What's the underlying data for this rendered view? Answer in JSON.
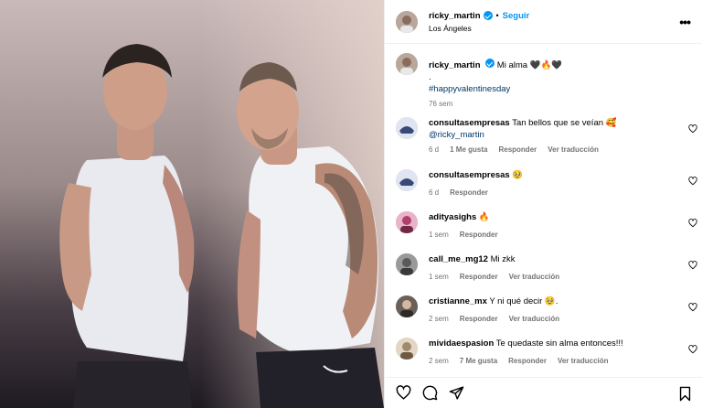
{
  "post": {
    "username": "ricky_martin",
    "follow_label": "Seguir",
    "separator": "•",
    "location": "Los Ángeles",
    "more_label": "•••"
  },
  "caption": {
    "username": "ricky_martin",
    "text": "Mi alma 🖤🔥🖤",
    "dot": ".",
    "hashtag": "#happyvalentinesday",
    "time": "76 sem"
  },
  "comments": [
    {
      "username": "consultasempresas",
      "text": "Tan bellos que se veían 🥰",
      "mention": "@ricky_martin",
      "time": "6 d",
      "likes": "1 Me gusta",
      "reply": "Responder",
      "translate": "Ver traducción",
      "avatar_color": "#3a4a78"
    },
    {
      "username": "consultasempresas",
      "text": "🥹",
      "mention": "",
      "time": "6 d",
      "likes": "",
      "reply": "Responder",
      "translate": "",
      "avatar_color": "#3a4a78"
    },
    {
      "username": "adityasighs",
      "text": "🔥",
      "mention": "",
      "time": "1 sem",
      "likes": "",
      "reply": "Responder",
      "translate": "",
      "avatar_color": "#b0406e"
    },
    {
      "username": "call_me_mg12",
      "text": "Mi zkk",
      "mention": "",
      "time": "1 sem",
      "likes": "",
      "reply": "Responder",
      "translate": "Ver traducción",
      "avatar_color": "#5a5a5a"
    },
    {
      "username": "cristianne_mx",
      "text": "Y ni qué decir 🥹.",
      "mention": "",
      "time": "2 sem",
      "likes": "",
      "reply": "Responder",
      "translate": "Ver traducción",
      "avatar_color": "#2e2a28"
    },
    {
      "username": "mividaespasion",
      "text": "Te quedaste sin alma entonces!!!",
      "mention": "",
      "time": "2 sem",
      "likes": "7 Me gusta",
      "reply": "Responder",
      "translate": "Ver traducción",
      "avatar_color": "#a08a6e"
    }
  ],
  "colors": {
    "verified": "#0095f6",
    "follow": "#0095f6",
    "link": "#00376b",
    "muted": "#737373",
    "border": "#efefef"
  },
  "icons": [
    "verified-badge-icon",
    "more-options-icon",
    "heart-icon",
    "comment-icon",
    "share-icon",
    "save-bookmark-icon"
  ]
}
